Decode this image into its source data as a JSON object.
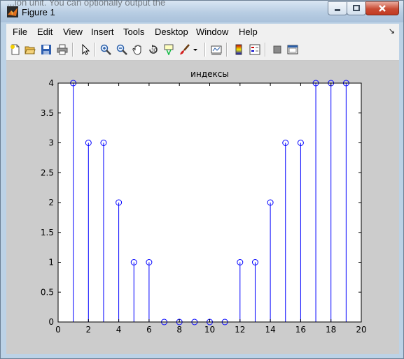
{
  "window": {
    "title": "Figure 1",
    "background_text": "...ion unit. You can optionally output the",
    "controls": {
      "minimize": "minimize",
      "maximize": "maximize",
      "close": "close"
    }
  },
  "menu": [
    "File",
    "Edit",
    "View",
    "Insert",
    "Tools",
    "Desktop",
    "Window",
    "Help"
  ],
  "toolbar": {
    "icons": [
      "new-figure-icon",
      "open-file-icon",
      "save-icon",
      "print-icon",
      "edit-plot-arrow-icon",
      "zoom-in-icon",
      "zoom-out-icon",
      "pan-hand-icon",
      "rotate-3d-icon",
      "data-cursor-icon",
      "brush-icon",
      "brush-dropdown-icon",
      "link-plot-icon",
      "insert-colorbar-icon",
      "insert-legend-icon",
      "hide-plot-tools-icon",
      "show-plot-tools-icon"
    ]
  },
  "colors": {
    "stem": "#0000ff",
    "axes_bg": "#ffffff",
    "figure_bg": "#cccccc"
  },
  "chart_data": {
    "type": "scatter",
    "style": "stem",
    "marker": "circle",
    "title": "индексы",
    "x": [
      1,
      2,
      3,
      4,
      5,
      6,
      7,
      8,
      9,
      10,
      11,
      12,
      13,
      14,
      15,
      16,
      17,
      18,
      19
    ],
    "y": [
      4,
      3,
      3,
      2,
      1,
      1,
      0,
      0,
      0,
      0,
      0,
      1,
      1,
      2,
      3,
      3,
      4,
      4,
      4
    ],
    "xlim": [
      0,
      20
    ],
    "ylim": [
      0,
      4
    ],
    "xticks": [
      "0",
      "2",
      "4",
      "6",
      "8",
      "10",
      "12",
      "14",
      "16",
      "18",
      "20"
    ],
    "yticks": [
      "0",
      "0.5",
      "1",
      "1.5",
      "2",
      "2.5",
      "3",
      "3.5",
      "4"
    ],
    "grid": false
  }
}
